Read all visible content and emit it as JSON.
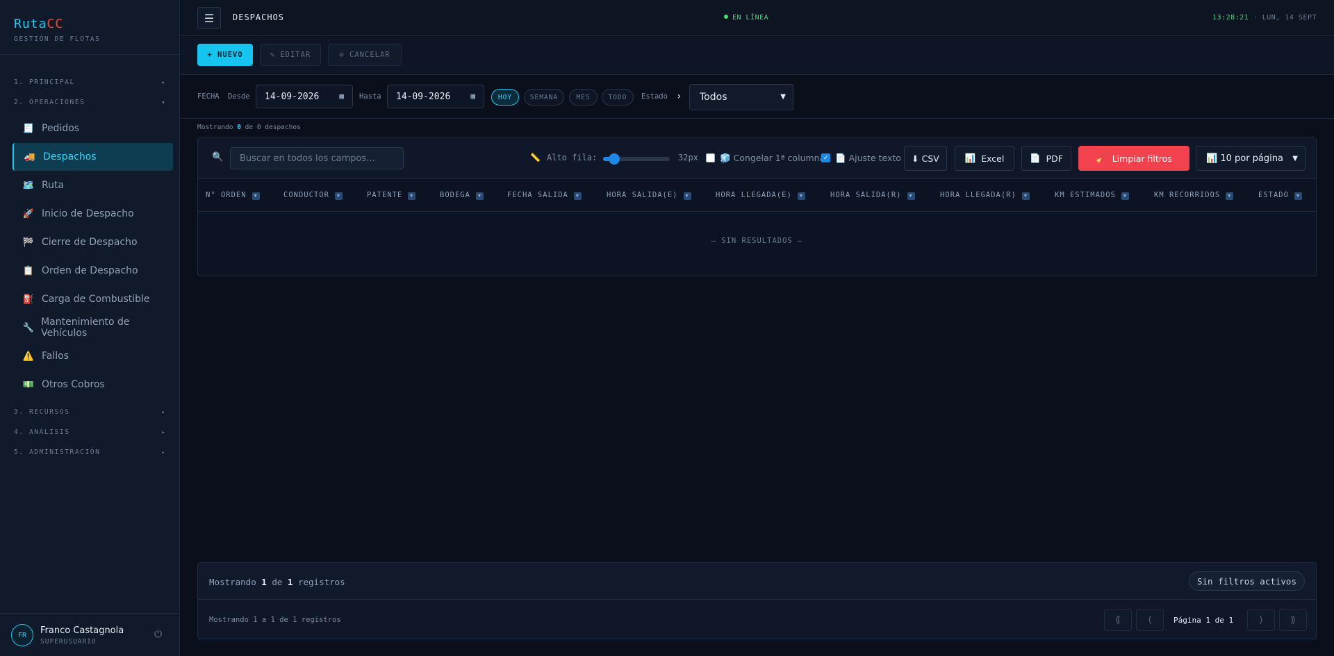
{
  "brand": {
    "name_a": "Ruta",
    "name_b": "CC",
    "subtitle": "GESTIÓN DE FLOTAS"
  },
  "sidebar": {
    "sections": [
      {
        "label": "1. PRINCIPAL",
        "arrow": "▸"
      },
      {
        "label": "2. OPERACIONES",
        "arrow": "▾"
      },
      {
        "label": "3. RECURSOS",
        "arrow": "▸"
      },
      {
        "label": "4. ANÁLISIS",
        "arrow": "▸"
      },
      {
        "label": "5. ADMINISTRACIÓN",
        "arrow": "▸"
      }
    ],
    "items": [
      {
        "label": "Pedidos",
        "icon": "🧾",
        "icon_name": "receipt-icon"
      },
      {
        "label": "Despachos",
        "icon": "🚚",
        "icon_name": "truck-icon",
        "active": true
      },
      {
        "label": "Ruta",
        "icon": "🗺️",
        "icon_name": "map-icon"
      },
      {
        "label": "Inicio de Despacho",
        "icon": "🚀",
        "icon_name": "rocket-icon"
      },
      {
        "label": "Cierre de Despacho",
        "icon": "🏁",
        "icon_name": "checkered-flag-icon"
      },
      {
        "label": "Orden de Despacho",
        "icon": "📋",
        "icon_name": "clipboard-icon"
      },
      {
        "label": "Carga de Combustible",
        "icon": "⛽",
        "icon_name": "fuel-pump-icon"
      },
      {
        "label": "Mantenimiento de Vehículos",
        "icon": "🔧",
        "icon_name": "wrench-icon"
      },
      {
        "label": "Fallos",
        "icon": "⚠️",
        "icon_name": "warning-icon"
      },
      {
        "label": "Otros Cobros",
        "icon": "💵",
        "icon_name": "money-icon"
      }
    ]
  },
  "user": {
    "initials": "FR",
    "name": "Franco Castagnola",
    "role": "SUPERUSUARIO"
  },
  "topbar": {
    "menu_icon": "☰",
    "title": "DESPACHOS",
    "status": "EN LÍNEA",
    "time": "13:28:21",
    "date": " · LUN, 14 SEPT"
  },
  "actions": {
    "new": "+ NUEVO",
    "edit": "✎ EDITAR",
    "cancel": "⊘ CANCELAR"
  },
  "filters": {
    "fecha": "FECHA",
    "desde": "Desde",
    "desde_value": "14-09-2026",
    "hasta": "Hasta",
    "hasta_value": "14-09-2026",
    "chips": [
      "HOY",
      "SEMANA",
      "MES",
      "TODO"
    ],
    "estado": "Estado",
    "estado_value": "Todos"
  },
  "showing": {
    "prefix": "Mostrando ",
    "shown": "0",
    "middle": " de ",
    "total": "0",
    "suffix": " despachos"
  },
  "toolbar": {
    "search_placeholder": "Buscar en todos los campos...",
    "row_height_label": "Alto fila:",
    "row_height_value": "32px",
    "row_height_fraction": 0.1,
    "freeze_label": "Congelar 1ª columna",
    "freeze_checked": false,
    "wrap_label": "Ajuste texto",
    "wrap_checked": true,
    "csv": "⬇ CSV",
    "excel": "Excel",
    "pdf": "PDF",
    "clear": "Limpiar filtros",
    "per_page": "10 por página"
  },
  "table": {
    "columns": [
      "N° ORDEN",
      "CONDUCTOR",
      "PATENTE",
      "BODEGA",
      "FECHA SALIDA",
      "HORA SALIDA(E)",
      "HORA LLEGADA(E)",
      "HORA SALIDA(R)",
      "HORA LLEGADA(R)",
      "KM ESTIMADOS",
      "KM RECORRIDOS",
      "ESTADO"
    ],
    "empty": "— SIN RESULTADOS —"
  },
  "footer": {
    "records_prefix": "Mostrando ",
    "records_a": "1",
    "records_mid": " de ",
    "records_b": "1",
    "records_suffix": " registros",
    "no_filters": "Sin filtros activos",
    "range_text": "Mostrando 1 a 1 de 1 registros",
    "page_text": "Página 1 de 1",
    "first": "⟪",
    "prev": "⟨",
    "next": "⟩",
    "last": "⟫"
  }
}
